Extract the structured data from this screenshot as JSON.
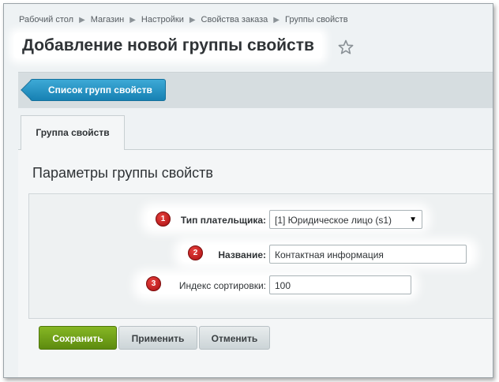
{
  "breadcrumb": [
    "Рабочий стол",
    "Магазин",
    "Настройки",
    "Свойства заказа",
    "Группы свойств"
  ],
  "header": {
    "title": "Добавление новой группы свойств",
    "favorite_icon": "star-icon"
  },
  "toolbar": {
    "list_button": "Список групп свойств"
  },
  "tabs": [
    {
      "label": "Группа свойств",
      "active": true
    }
  ],
  "section": {
    "title": "Параметры группы свойств"
  },
  "form": {
    "payer_type": {
      "badge": "1",
      "label": "Тип плательщика:",
      "value": "[1] Юридическое лицо (s1)",
      "arrow": "▼"
    },
    "name": {
      "badge": "2",
      "label": "Название:",
      "value": "Контактная информация"
    },
    "sort_index": {
      "badge": "3",
      "label": "Индекс сортировки:",
      "value": "100"
    }
  },
  "buttons": {
    "save": "Сохранить",
    "apply": "Применить",
    "cancel": "Отменить"
  },
  "colors": {
    "accent_blue": "#1e8fc4",
    "save_green": "#6e9e16",
    "badge_red": "#c41a1a"
  }
}
